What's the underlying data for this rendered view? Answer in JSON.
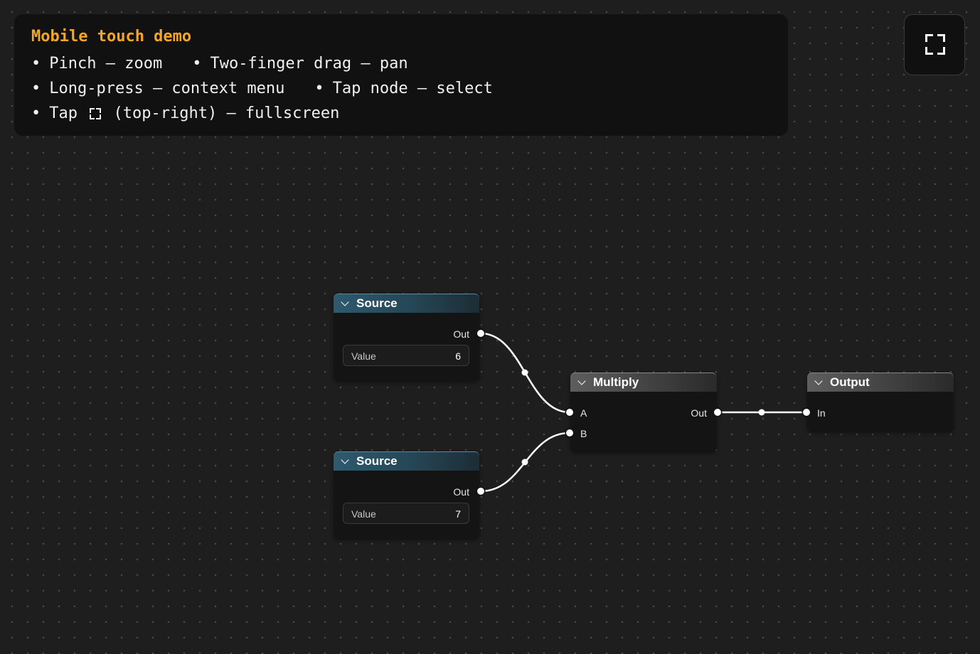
{
  "help": {
    "title": "Mobile touch demo",
    "bullet": "•",
    "pinch": "Pinch — zoom",
    "pan": "Two-finger drag — pan",
    "long_press": "Long-press — context menu",
    "tap_select": "Tap node — select",
    "fullscreen_pre": "Tap",
    "fullscreen_post": "(top-right) — fullscreen"
  },
  "nodes": {
    "source1": {
      "title": "Source",
      "out_label": "Out",
      "field_label": "Value",
      "field_value": "6"
    },
    "source2": {
      "title": "Source",
      "out_label": "Out",
      "field_label": "Value",
      "field_value": "7"
    },
    "multiply": {
      "title": "Multiply",
      "in_a": "A",
      "in_b": "B",
      "out_label": "Out"
    },
    "output": {
      "title": "Output",
      "in_label": "In"
    }
  },
  "colors": {
    "accent": "#f5a623",
    "canvas_bg": "#1e1e1e",
    "wire": "#ffffff",
    "source_header": "#2e5a6e",
    "generic_header": "#5e5e5e"
  },
  "icons": {
    "fullscreen": "fullscreen-icon",
    "collapse": "chevron-down-icon"
  }
}
